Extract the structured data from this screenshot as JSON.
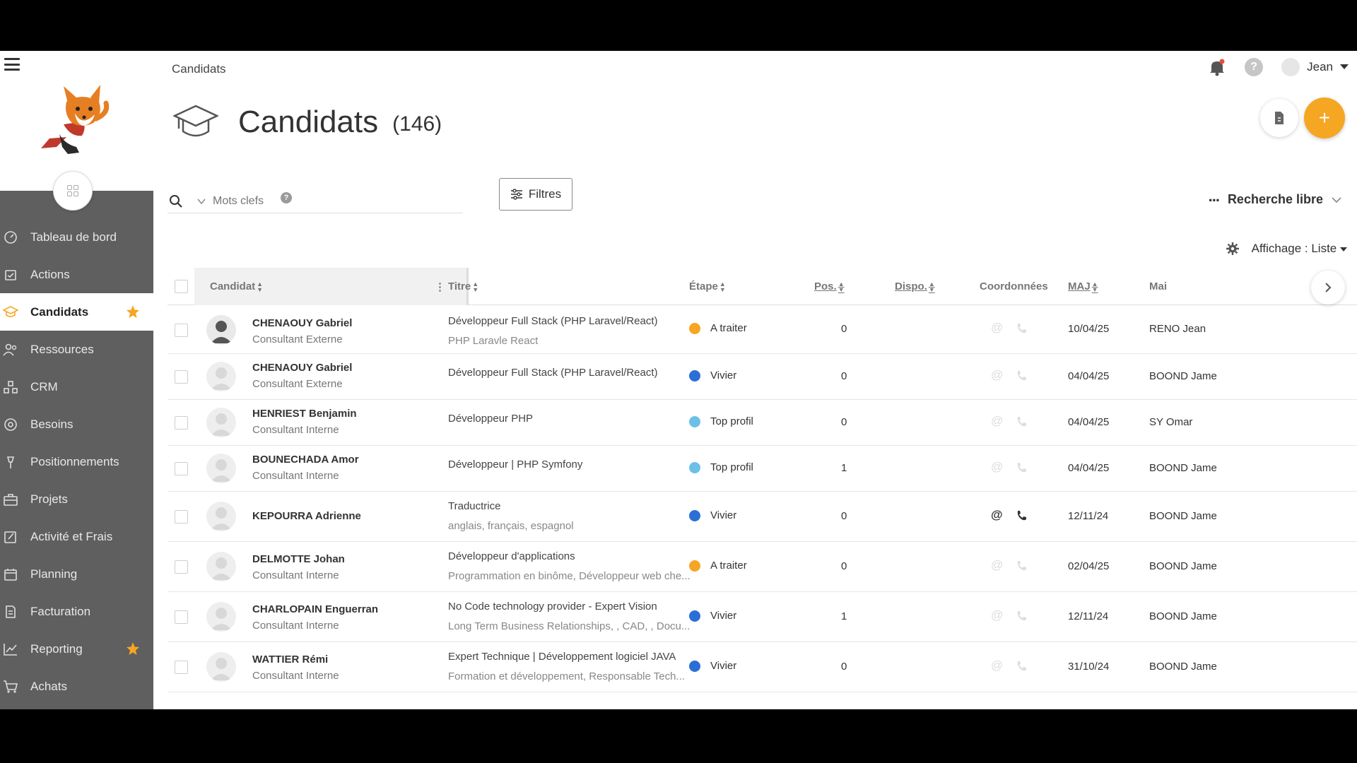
{
  "breadcrumb": "Candidats",
  "user": {
    "name": "Jean"
  },
  "page": {
    "title": "Candidats",
    "count": "(146)"
  },
  "search": {
    "placeholder": "Mots clefs",
    "help": "?"
  },
  "toolbar": {
    "filters_label": "Filtres",
    "free_search_label": "Recherche libre",
    "display_label": "Affichage : Liste",
    "add_label": "+"
  },
  "sidebar": {
    "items": [
      {
        "label": "Tableau de bord",
        "icon": "dashboard-icon"
      },
      {
        "label": "Actions",
        "icon": "actions-icon"
      },
      {
        "label": "Candidats",
        "icon": "graduation-cap-icon",
        "active": true,
        "starred": true
      },
      {
        "label": "Ressources",
        "icon": "people-icon"
      },
      {
        "label": "CRM",
        "icon": "crm-icon"
      },
      {
        "label": "Besoins",
        "icon": "target-icon"
      },
      {
        "label": "Positionnements",
        "icon": "pin-icon"
      },
      {
        "label": "Projets",
        "icon": "briefcase-icon"
      },
      {
        "label": "Activité et Frais",
        "icon": "edit-icon"
      },
      {
        "label": "Planning",
        "icon": "calendar-icon"
      },
      {
        "label": "Facturation",
        "icon": "invoice-icon"
      },
      {
        "label": "Reporting",
        "icon": "chart-icon",
        "starred": true
      },
      {
        "label": "Achats",
        "icon": "cart-icon"
      }
    ]
  },
  "table": {
    "columns": {
      "candidat": "Candidat",
      "titre": "Titre",
      "etape": "Étape",
      "pos": "Pos.",
      "dispo": "Dispo.",
      "coordonnees": "Coordonnées",
      "maj": "MAJ",
      "manager": "Mai"
    },
    "rows": [
      {
        "name": "CHENAOUY Gabriel",
        "role": "Consultant Externe",
        "title": "Développeur Full Stack (PHP Laravel/React)",
        "sub": "PHP Laravle React",
        "stage": "A traiter",
        "stage_color": "#f5a623",
        "pos": "0",
        "maj": "10/04/25",
        "manager": "RENO Jean",
        "photo": true
      },
      {
        "name": "CHENAOUY Gabriel",
        "role": "Consultant Externe",
        "title": "Développeur Full Stack (PHP Laravel/React)",
        "sub": "",
        "stage": "Vivier",
        "stage_color": "#2a6fd6",
        "pos": "0",
        "maj": "04/04/25",
        "manager": "BOOND Jame"
      },
      {
        "name": "HENRIEST Benjamin",
        "role": "Consultant Interne",
        "title": "Développeur PHP",
        "sub": "",
        "stage": "Top profil",
        "stage_color": "#6cc0e8",
        "pos": "0",
        "maj": "04/04/25",
        "manager": "SY Omar"
      },
      {
        "name": "BOUNECHADA Amor",
        "role": "Consultant Interne",
        "title": "Développeur | PHP Symfony",
        "sub": "",
        "stage": "Top profil",
        "stage_color": "#6cc0e8",
        "pos": "1",
        "maj": "04/04/25",
        "manager": "BOOND Jame"
      },
      {
        "name": "KEPOURRA Adrienne",
        "role": "",
        "title": "Traductrice",
        "sub": "anglais, français, espagnol",
        "stage": "Vivier",
        "stage_color": "#2a6fd6",
        "pos": "0",
        "maj": "12/11/24",
        "manager": "BOOND Jame",
        "contact": true
      },
      {
        "name": "DELMOTTE Johan",
        "role": "Consultant Interne",
        "title": "Développeur d'applications",
        "sub": "Programmation en binôme, Développeur web che...",
        "stage": "A traiter",
        "stage_color": "#f5a623",
        "pos": "0",
        "maj": "02/04/25",
        "manager": "BOOND Jame"
      },
      {
        "name": "CHARLOPAIN Enguerran",
        "role": "Consultant Interne",
        "title": "No Code technology provider - Expert Vision",
        "sub": "Long Term Business Relationships, , CAD, , Docu...",
        "stage": "Vivier",
        "stage_color": "#2a6fd6",
        "pos": "1",
        "maj": "12/11/24",
        "manager": "BOOND Jame"
      },
      {
        "name": "WATTIER Rémi",
        "role": "Consultant Interne",
        "title": "Expert Technique | Développement logiciel JAVA",
        "sub": "Formation et développement, Responsable Tech...",
        "stage": "Vivier",
        "stage_color": "#2a6fd6",
        "pos": "0",
        "maj": "31/10/24",
        "manager": "BOOND Jame"
      }
    ]
  }
}
